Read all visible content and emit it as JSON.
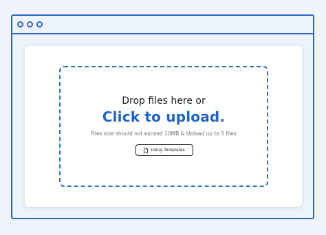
{
  "dropzone": {
    "line1": "Drop files here or",
    "line2": "Click to upload.",
    "hint": "Files size should not exceed 10MB &  Upload up to 5 files",
    "template_button_label": "Using Templates"
  },
  "colors": {
    "accent": "#1e63c6",
    "window_border": "#2d65bf",
    "background": "#eef3fc"
  },
  "icons": {
    "template_button": "file-icon"
  }
}
